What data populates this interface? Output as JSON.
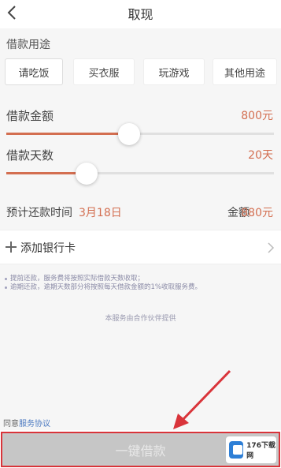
{
  "header": {
    "title": "取现",
    "back_icon": "chevron-left-icon"
  },
  "purpose": {
    "label": "借款用途",
    "options": [
      "请吃饭",
      "买衣服",
      "玩游戏",
      "其他用途"
    ],
    "selected": "请吃饭"
  },
  "amount": {
    "label": "借款金额",
    "value": "800元",
    "slider_fraction": 0.46
  },
  "days": {
    "label": "借款天数",
    "value": "20天",
    "slider_fraction": 0.3
  },
  "repay": {
    "label": "预计还款时间",
    "date": "3月18日",
    "total_label": "金额",
    "total_value": "880元"
  },
  "bank_card": {
    "label": "添加银行卡",
    "plus_icon": "plus-icon",
    "chevron_icon": "chevron-right-icon"
  },
  "notes": [
    "提前还款，服务费将按照实际借款天数收取；",
    "逾期还款，逾期天数部分将按照每天借款金额的1%收取服务费。"
  ],
  "provider_text": "本服务由合作伙伴提供",
  "agreement": {
    "prefix": "同意",
    "link": "服务协议"
  },
  "cta": {
    "label": "一键借款"
  },
  "watermark": {
    "text": "176下载网"
  },
  "colors": {
    "accent": "#d36e50",
    "highlight_frame": "#d9343a",
    "link": "#4a78c0"
  }
}
